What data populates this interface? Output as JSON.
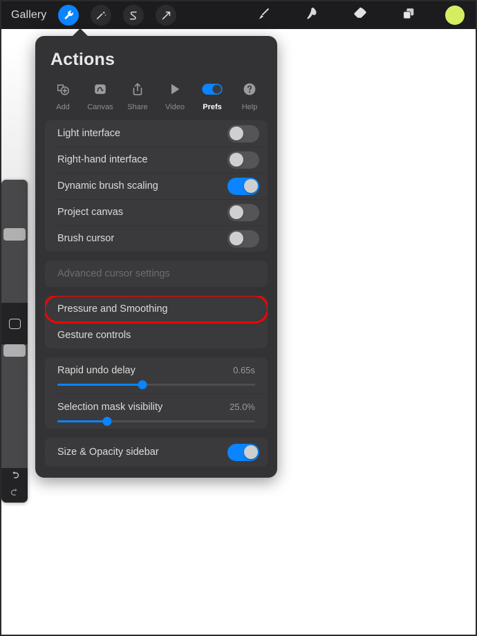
{
  "app": {
    "canvas_background": "#ffffff",
    "accent_color": "#0a84ff",
    "highlight_color": "#ff0000"
  },
  "toolbar": {
    "gallery_label": "Gallery",
    "left_tools": [
      {
        "name": "actions-wrench",
        "icon": "wrench-icon",
        "active": true
      },
      {
        "name": "adjustments",
        "icon": "magic-wand-icon",
        "active": false
      },
      {
        "name": "selection",
        "icon": "s-curve-icon",
        "active": false
      },
      {
        "name": "transform",
        "icon": "arrow-move-icon",
        "active": false
      }
    ],
    "right_tools": [
      {
        "name": "paint",
        "icon": "brush-icon"
      },
      {
        "name": "smudge",
        "icon": "smudge-icon"
      },
      {
        "name": "erase",
        "icon": "eraser-icon"
      },
      {
        "name": "layers",
        "icon": "layers-icon"
      }
    ],
    "color_swatch": "#d4ed61"
  },
  "sidebar": {
    "brush_size_label": "brush-size-slider",
    "brush_opacity_label": "brush-opacity-slider",
    "modify_button": "modify-button",
    "undo_icon": "undo-arrow-icon",
    "redo_icon": "redo-arrow-icon"
  },
  "panel": {
    "title": "Actions",
    "tabs": [
      {
        "label": "Add",
        "icon": "add-icon",
        "active": false
      },
      {
        "label": "Canvas",
        "icon": "canvas-icon",
        "active": false
      },
      {
        "label": "Share",
        "icon": "share-icon",
        "active": false
      },
      {
        "label": "Video",
        "icon": "video-play-icon",
        "active": false
      },
      {
        "label": "Prefs",
        "icon": "toggle-icon",
        "active": true
      },
      {
        "label": "Help",
        "icon": "question-mark-icon",
        "active": false
      }
    ],
    "toggle_rows": [
      {
        "label": "Light interface",
        "on": false
      },
      {
        "label": "Right-hand interface",
        "on": false
      },
      {
        "label": "Dynamic brush scaling",
        "on": true
      },
      {
        "label": "Project canvas",
        "on": false
      },
      {
        "label": "Brush cursor",
        "on": false
      }
    ],
    "link_rows_group_a": [
      {
        "label": "Advanced cursor settings",
        "disabled": true,
        "highlighted": false
      }
    ],
    "link_rows_group_b": [
      {
        "label": "Pressure and Smoothing",
        "disabled": false,
        "highlighted": true
      },
      {
        "label": "Gesture controls",
        "disabled": false,
        "highlighted": false
      }
    ],
    "sliders": [
      {
        "label": "Rapid undo delay",
        "value": "0.65s",
        "percent": 43
      },
      {
        "label": "Selection mask visibility",
        "value": "25.0%",
        "percent": 25
      }
    ],
    "footer_rows": [
      {
        "label": "Size & Opacity sidebar",
        "on": true
      }
    ]
  }
}
